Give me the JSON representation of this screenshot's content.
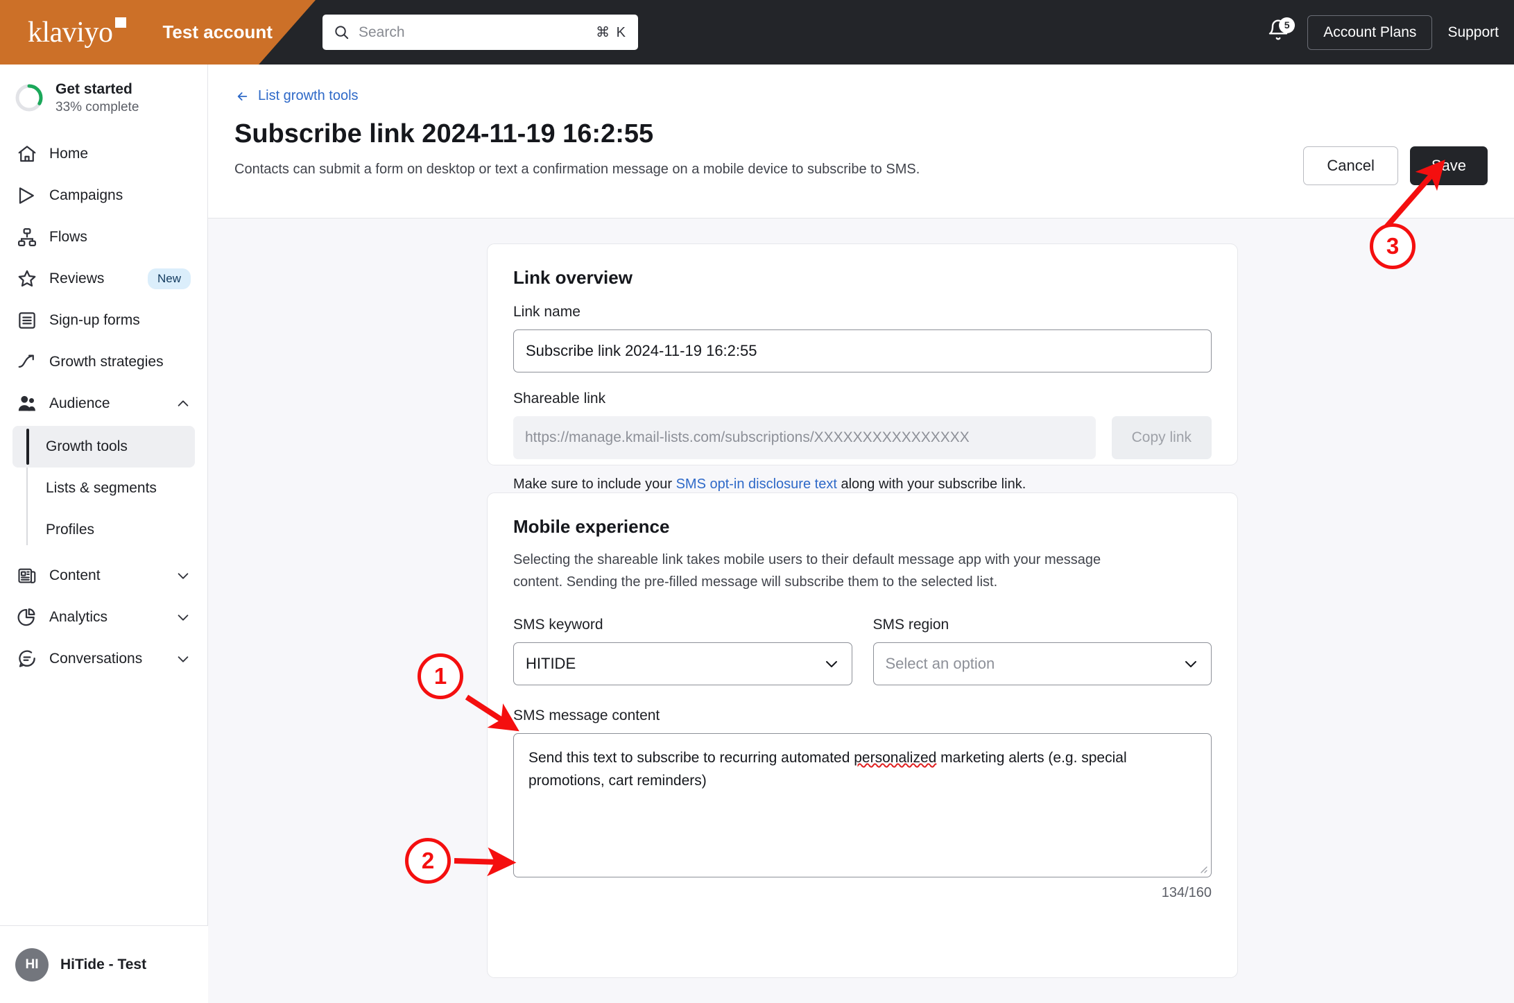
{
  "topbar": {
    "logo": "klaviyo",
    "account_name": "Test account",
    "search_placeholder": "Search",
    "search_value": "",
    "search_shortcut": "⌘ K",
    "notification_count": "5",
    "account_plans_label": "Account Plans",
    "support_label": "Support"
  },
  "sidebar": {
    "get_started": {
      "title": "Get started",
      "subtitle": "33% complete",
      "percent": 33
    },
    "items": [
      {
        "label": "Home",
        "icon": "home-icon"
      },
      {
        "label": "Campaigns",
        "icon": "send-icon"
      },
      {
        "label": "Flows",
        "icon": "flows-icon"
      },
      {
        "label": "Reviews",
        "icon": "star-icon",
        "badge": "New"
      },
      {
        "label": "Sign-up forms",
        "icon": "form-icon"
      },
      {
        "label": "Growth strategies",
        "icon": "trending-up-icon"
      },
      {
        "label": "Audience",
        "icon": "audience-icon",
        "expanded": true
      },
      {
        "label": "Content",
        "icon": "content-icon",
        "expanded": false
      },
      {
        "label": "Analytics",
        "icon": "pie-chart-icon",
        "expanded": false
      },
      {
        "label": "Conversations",
        "icon": "chat-icon",
        "expanded": false
      }
    ],
    "audience_subitems": [
      {
        "label": "Growth tools",
        "active": true
      },
      {
        "label": "Lists & segments",
        "active": false
      },
      {
        "label": "Profiles",
        "active": false
      }
    ],
    "user": {
      "initials": "HI",
      "name": "HiTide - Test"
    }
  },
  "page": {
    "back_link": "List growth tools",
    "title": "Subscribe link 2024-11-19 16:2:55",
    "description": "Contacts can submit a form on desktop or text a confirmation message on a mobile device to subscribe to SMS.",
    "cancel_label": "Cancel",
    "save_label": "Save"
  },
  "link_overview": {
    "card_title": "Link overview",
    "link_name_label": "Link name",
    "link_name_value": "Subscribe link 2024-11-19 16:2:55",
    "shareable_link_label": "Shareable link",
    "shareable_link_placeholder": "https://manage.kmail-lists.com/subscriptions/XXXXXXXXXXXXXXXX",
    "shareable_link_value": "",
    "copy_link_label": "Copy link",
    "helper_prefix": "Make sure to include your ",
    "helper_link": "SMS opt-in disclosure text",
    "helper_suffix": " along with your subscribe link."
  },
  "mobile_experience": {
    "card_title": "Mobile experience",
    "description": "Selecting the shareable link takes mobile users to their default message app with your message content. Sending the pre-filled message will subscribe them to the selected list.",
    "sms_keyword_label": "SMS keyword",
    "sms_keyword_value": "HITIDE",
    "sms_region_label": "SMS region",
    "sms_region_placeholder": "Select an option",
    "sms_message_label": "SMS message content",
    "sms_message_part1": "Send this text to subscribe to recurring automated ",
    "sms_message_misspelled": "personalized",
    "sms_message_part2": " marketing alerts (e.g. special promotions, cart reminders)",
    "char_count": "134/160"
  },
  "annotations": [
    {
      "number": "1",
      "target": "sms-keyword-select"
    },
    {
      "number": "2",
      "target": "sms-message-textarea"
    },
    {
      "number": "3",
      "target": "save-button"
    }
  ],
  "colors": {
    "brand_orange": "#cc7028",
    "topbar_dark": "#232529",
    "link_blue": "#2e69c8",
    "annotation_red": "#f40f0f",
    "progress_green": "#1ba85a",
    "badge_blue_bg": "#dbeefb"
  }
}
